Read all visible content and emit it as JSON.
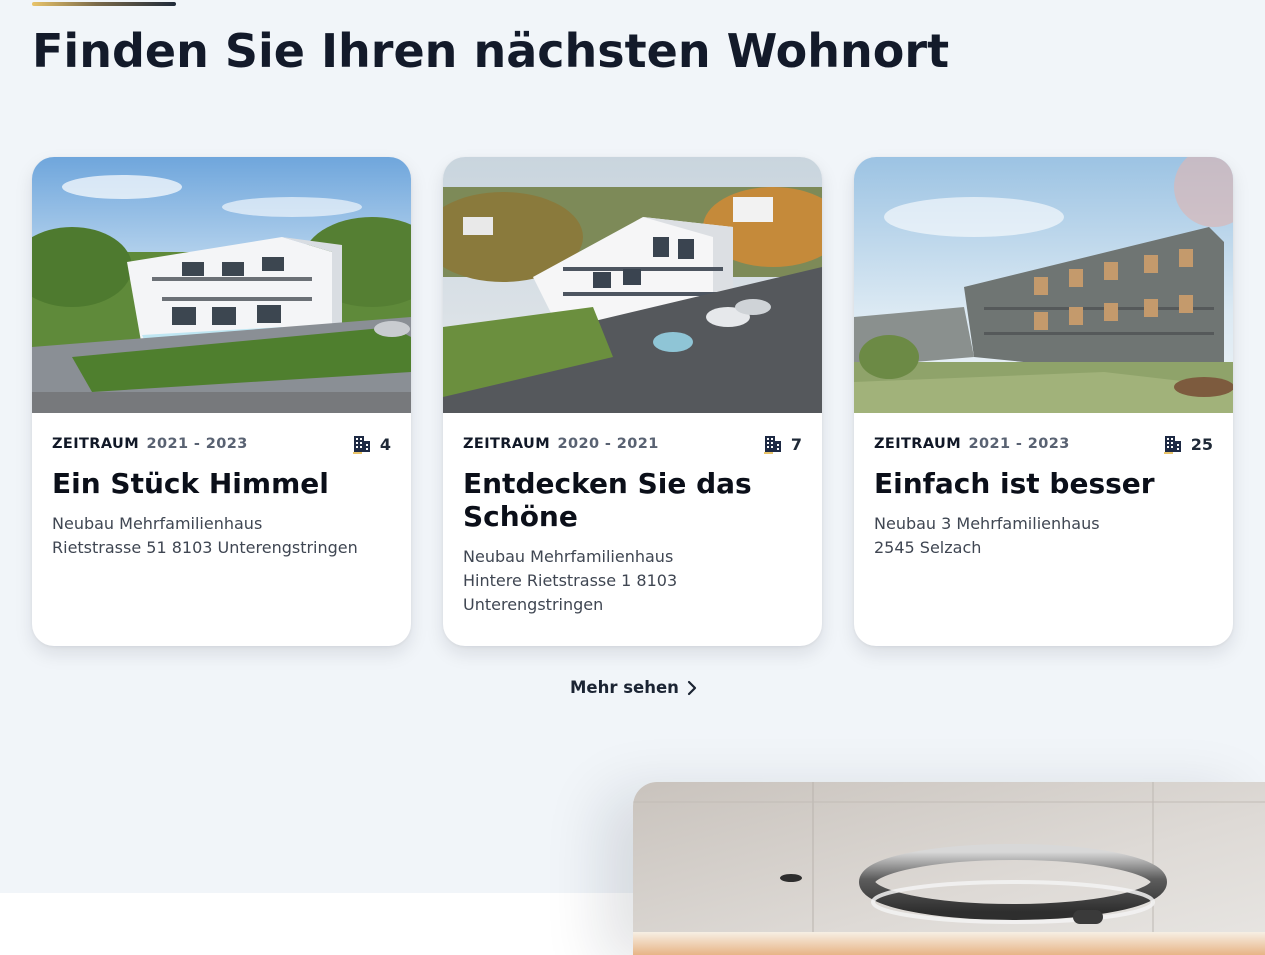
{
  "section": {
    "title": "Finden Sie Ihren nächsten Wohnort",
    "more_label": "Mehr sehen"
  },
  "cards": [
    {
      "period_label": "ZEITRAUM",
      "period_value": "2021 - 2023",
      "units": "4",
      "title": "Ein Stück Himmel",
      "desc_line1": "Neubau Mehrfamilienhaus",
      "desc_line2": "Rietstrasse 51 8103 Unterengstringen",
      "desc_line3": ""
    },
    {
      "period_label": "ZEITRAUM",
      "period_value": "2020 - 2021",
      "units": "7",
      "title": "Entdecken Sie das Schöne",
      "desc_line1": "Neubau Mehrfamilienhaus",
      "desc_line2": "Hintere Rietstrasse 1 8103",
      "desc_line3": "Unterengstringen"
    },
    {
      "period_label": "ZEITRAUM",
      "period_value": "2021 - 2023",
      "units": "25",
      "title": "Einfach ist besser",
      "desc_line1": "Neubau 3 Mehrfamilienhaus",
      "desc_line2": "2545 Selzach",
      "desc_line3": ""
    }
  ],
  "icons": {
    "units": "building-icon",
    "more": "chevron-right-icon"
  },
  "colors": {
    "background": "#f1f5f9",
    "heading": "#131a2a",
    "accent_gold": "#e9c46a",
    "icon_navy": "#1e2a44"
  }
}
